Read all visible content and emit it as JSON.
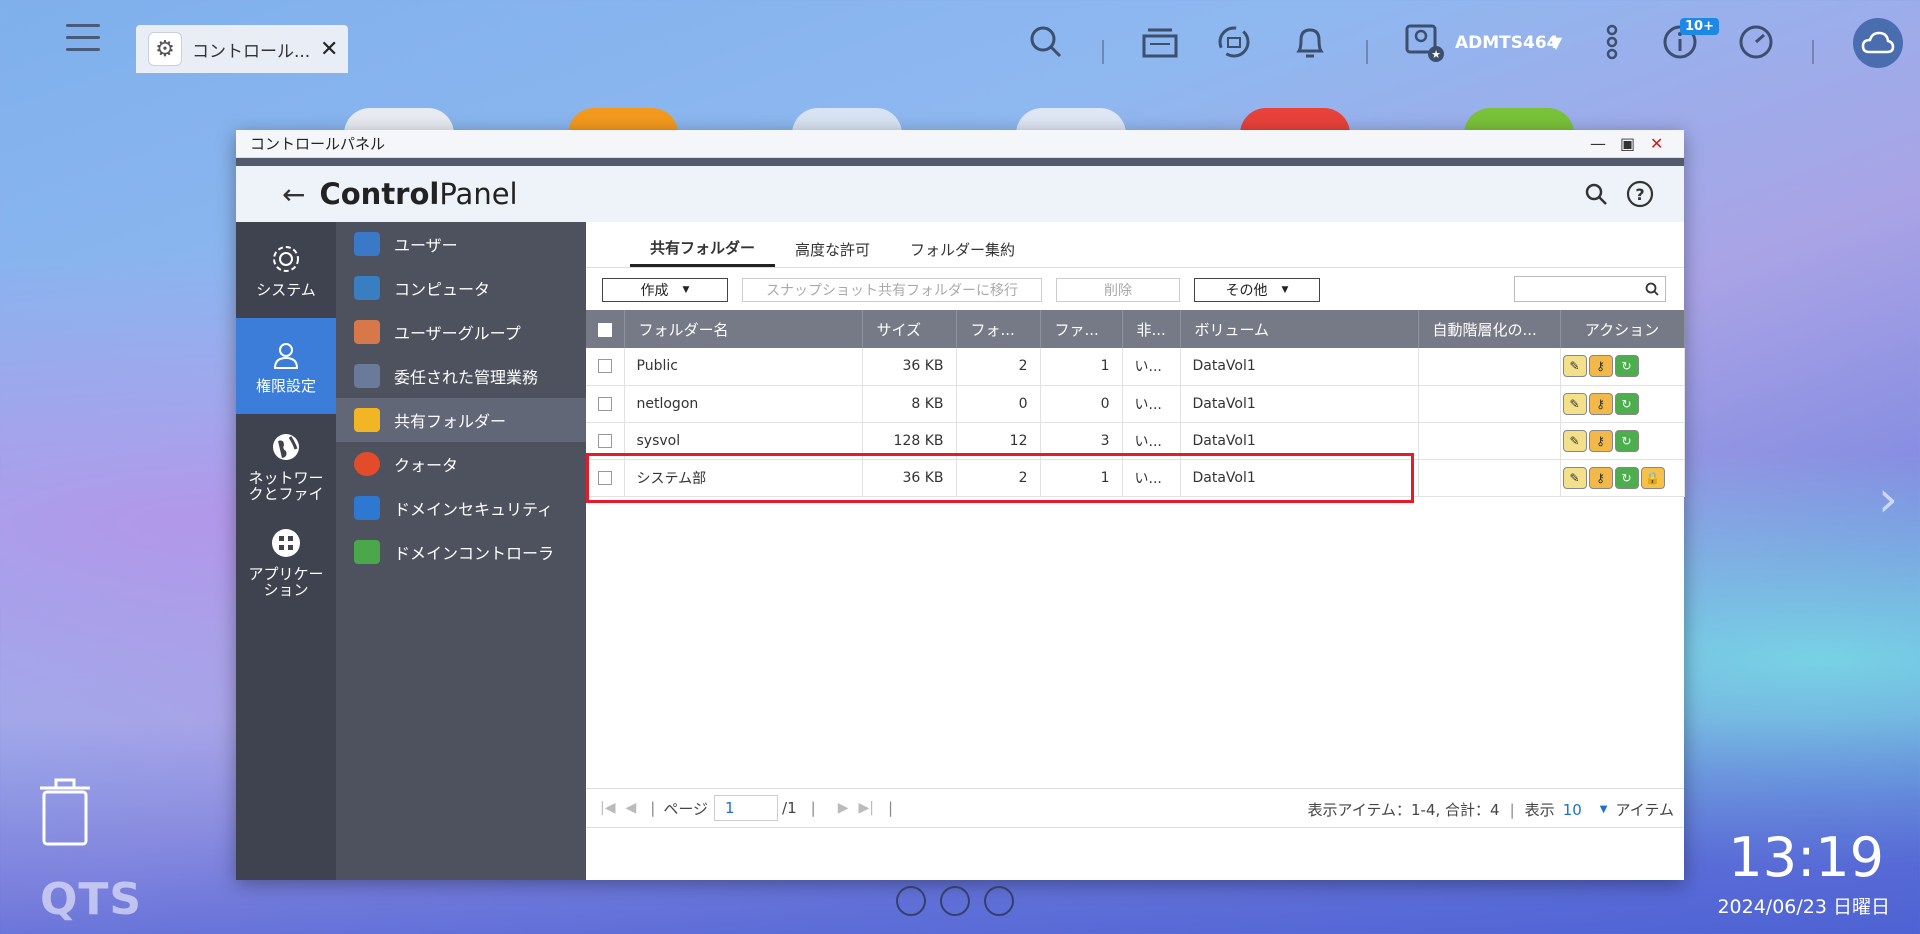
{
  "topbar": {
    "app_tab_label": "コントロール...",
    "user": "ADMTS464",
    "notification_badge": "10+"
  },
  "window": {
    "title": "コントロールパネル",
    "header_bold": "Control",
    "header_rest": "Panel"
  },
  "nav_primary": [
    {
      "label": "システム",
      "icon": "gear-icon"
    },
    {
      "label": "権限設定",
      "icon": "user-icon"
    },
    {
      "label": "ネットワークとファイ",
      "icon": "globe-icon"
    },
    {
      "label": "アプリケーション",
      "icon": "apps-icon"
    }
  ],
  "nav_secondary": [
    {
      "label": "ユーザー",
      "color": "#3a78c8"
    },
    {
      "label": "コンピュータ",
      "color": "#3a7ec2"
    },
    {
      "label": "ユーザーグループ",
      "color": "#d6784a"
    },
    {
      "label": "委任された管理業務",
      "color": "#6a7a9a"
    },
    {
      "label": "共有フォルダー",
      "color": "#f2b625"
    },
    {
      "label": "クォータ",
      "color": "#e44b2a"
    },
    {
      "label": "ドメインセキュリティ",
      "color": "#2d78d0"
    },
    {
      "label": "ドメインコントローラ",
      "color": "#4aa84a"
    }
  ],
  "tabs": [
    {
      "label": "共有フォルダー"
    },
    {
      "label": "高度な許可"
    },
    {
      "label": "フォルダー集約"
    }
  ],
  "toolbar": {
    "create": "作成",
    "snapshot": "スナップショット共有フォルダーに移行",
    "delete": "削除",
    "other": "その他"
  },
  "table": {
    "headers": [
      "フォルダー名",
      "サイズ",
      "フォ...",
      "ファ...",
      "非...",
      "ボリューム",
      "自動階層化の...",
      "アクション"
    ],
    "rows": [
      {
        "name": "Public",
        "size": "36 KB",
        "folders": "2",
        "files": "1",
        "hidden": "い...",
        "volume": "DataVol1"
      },
      {
        "name": "netlogon",
        "size": "8 KB",
        "folders": "0",
        "files": "0",
        "hidden": "い...",
        "volume": "DataVol1"
      },
      {
        "name": "sysvol",
        "size": "128 KB",
        "folders": "12",
        "files": "3",
        "hidden": "い...",
        "volume": "DataVol1"
      },
      {
        "name": "システム部",
        "size": "36 KB",
        "folders": "2",
        "files": "1",
        "hidden": "い...",
        "volume": "DataVol1"
      }
    ]
  },
  "pager": {
    "page_label": "ページ",
    "page_value": "1",
    "page_total": "/1",
    "summary": "表示アイテム：1-4, 合計：4",
    "show_label": "表示",
    "per_page": "10",
    "items_label": "アイテム"
  },
  "desktop": {
    "logo": "QTS",
    "time": "13:19",
    "date": "2024/06/23 日曜日"
  },
  "colors": {
    "highlight": "#e41b2b",
    "accent": "#3b7dd8"
  }
}
